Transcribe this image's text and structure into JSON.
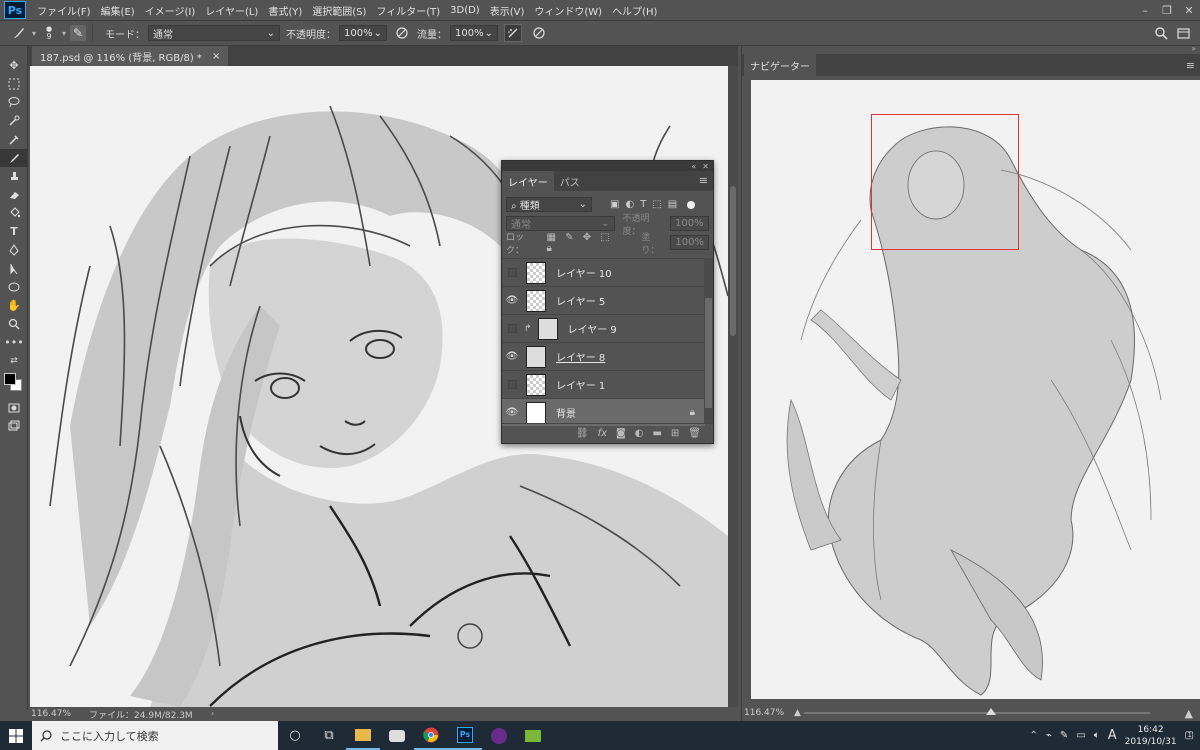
{
  "app": {
    "logo": "Ps"
  },
  "menu": [
    "ファイル(F)",
    "編集(E)",
    "イメージ(I)",
    "レイヤー(L)",
    "書式(Y)",
    "選択範囲(S)",
    "フィルター(T)",
    "3D(D)",
    "表示(V)",
    "ウィンドウ(W)",
    "ヘルプ(H)"
  ],
  "options": {
    "brush_size": "9",
    "mode_label": "モード：",
    "mode_value": "通常",
    "opacity_label": "不透明度：",
    "opacity_value": "100%",
    "flow_label": "流量：",
    "flow_value": "100%"
  },
  "document": {
    "tab_title": "187.psd @ 116% (背景, RGB/8) *",
    "close": "×",
    "zoom": "116.47%",
    "file_info": "ファイル：24.9M/82.3M"
  },
  "navigator": {
    "tab": "ナビゲーター",
    "zoom": "116.47%"
  },
  "layers_panel": {
    "tab_layers": "レイヤー",
    "tab_paths": "パス",
    "filter_kind": "種類",
    "blend_mode": "通常",
    "opacity_label": "不透明度：",
    "opacity_value": "100%",
    "lock_label": "ロック：",
    "fill_label": "塗り：",
    "fill_value": "100%",
    "layers": [
      {
        "name": "レイヤー 10",
        "visible": false
      },
      {
        "name": "レイヤー 5",
        "visible": true
      },
      {
        "name": "レイヤー 9",
        "visible": false,
        "clipped": true
      },
      {
        "name": "レイヤー 8",
        "visible": true
      },
      {
        "name": "レイヤー 1",
        "visible": false
      },
      {
        "name": "背景",
        "visible": true,
        "locked": true,
        "selected": true
      }
    ]
  },
  "taskbar": {
    "search_placeholder": "ここに入力して検索",
    "ime": "A",
    "time": "16:42",
    "date": "2019/10/31",
    "notifications": "1"
  },
  "colors": {
    "accent_nav_rect": "#e0303a",
    "ps_blue": "#31a8ff"
  }
}
